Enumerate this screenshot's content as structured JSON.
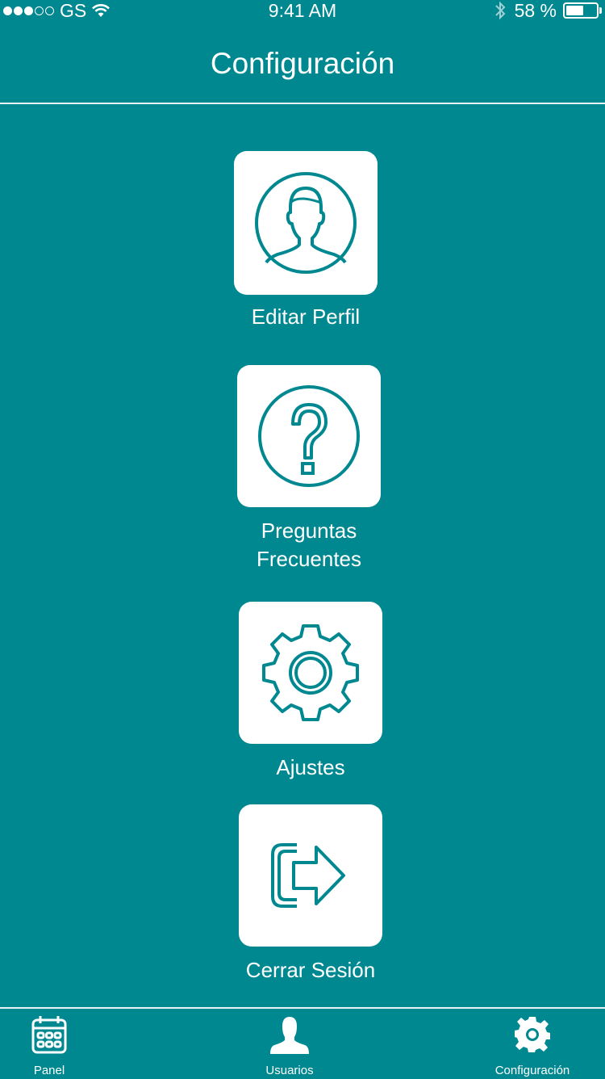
{
  "status_bar": {
    "carrier": "GS",
    "time": "9:41 AM",
    "battery_percent": "58 %",
    "battery_level": 0.58,
    "signal_bars_filled": 3,
    "signal_bars_total": 5
  },
  "nav": {
    "title": "Configuración"
  },
  "menu": {
    "items": [
      {
        "label": "Editar Perfil",
        "icon": "user-profile-icon"
      },
      {
        "label_line1": "Preguntas",
        "label_line2": "Frecuentes",
        "icon": "question-icon"
      },
      {
        "label": "Ajustes",
        "icon": "gear-icon"
      },
      {
        "label": "Cerrar Sesión",
        "icon": "logout-icon"
      }
    ]
  },
  "tab_bar": {
    "tabs": [
      {
        "label": "Panel",
        "icon": "calendar-icon"
      },
      {
        "label": "Usuarios",
        "icon": "user-icon"
      },
      {
        "label": "Configuración",
        "icon": "gear-icon",
        "active": true
      }
    ]
  },
  "colors": {
    "background": "#008891",
    "tile": "#ffffff",
    "icon": "#008891",
    "text": "#ffffff"
  }
}
